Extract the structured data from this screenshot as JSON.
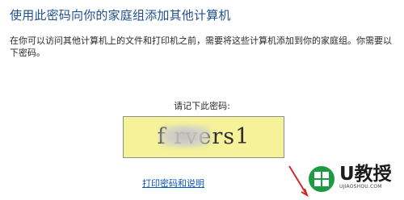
{
  "page": {
    "title": "使用此密码向你的家庭组添加其他计算机",
    "description": "在你可以访问其他计算机上的文件和打印机之前，需要将这些计算机添加到你的家庭组。你需要以下密码。",
    "prompt": "请记下此密码:",
    "password_value": "f     rvers1",
    "print_link_label": "打印密码和说明"
  },
  "watermark": {
    "logo_text": "U教授",
    "logo_subtext": "UJIAOSHOU.COM"
  },
  "colors": {
    "title": "#1f4f8f",
    "password_box_bg": "#f5f29a",
    "link": "#0a57b8",
    "logo_green": "#1e9a42",
    "arrow_red": "#cc2b2b"
  },
  "icons": {
    "logo_mark": "windows-logo-icon",
    "pointer": "red-arrow-icon"
  }
}
